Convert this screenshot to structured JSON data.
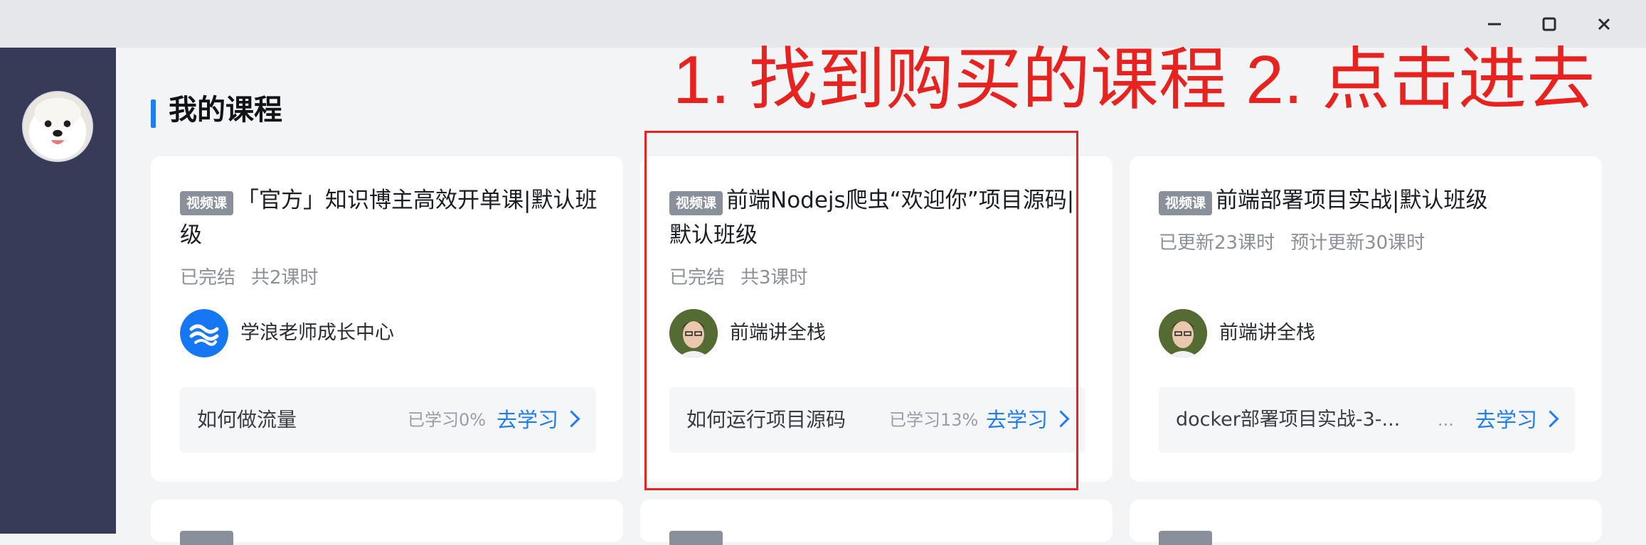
{
  "window": {
    "controls": [
      {
        "icon": "minimize-icon"
      },
      {
        "icon": "maximize-icon"
      },
      {
        "icon": "close-icon"
      }
    ]
  },
  "sidebar": {
    "avatar_icon": "samoyed-dog-avatar-icon"
  },
  "section": {
    "title": "我的课程"
  },
  "annotation": {
    "text": "1. 找到购买的课程 2. 点击进去",
    "color": "#e8231f"
  },
  "courses": [
    {
      "tag": "视频课",
      "title": "「官方」知识博主高效开单课|默认班级",
      "status": "已完结",
      "lessons": "共2课时",
      "teacher": "学浪老师成长中心",
      "teacher_avatar_icon": "xuelang-logo-icon",
      "last_lesson": "如何做流量",
      "progress_text": "已学习0%",
      "progress": 0,
      "go_label": "去学习"
    },
    {
      "tag": "视频课",
      "title": "前端Nodejs爬虫“欢迎你”项目源码|默认班级",
      "status": "已完结",
      "lessons": "共3课时",
      "teacher": "前端讲全栈",
      "teacher_avatar_icon": "teacher-photo-avatar-icon",
      "last_lesson": "如何运行项目源码",
      "progress_text": "已学习13%",
      "progress": 13,
      "go_label": "去学习"
    },
    {
      "tag": "视频课",
      "title": "前端部署项目实战|默认班级",
      "status": "已更新23课时",
      "lessons": "预计更新30课时",
      "teacher": "前端讲全栈",
      "teacher_avatar_icon": "teacher-photo-avatar-icon",
      "last_lesson": "docker部署项目实战-3-...",
      "dots": "...",
      "go_label": "去学习"
    }
  ],
  "colors": {
    "accent": "#1f7cf4",
    "sidebar": "#383b57",
    "tag": "#8a8f9c"
  }
}
